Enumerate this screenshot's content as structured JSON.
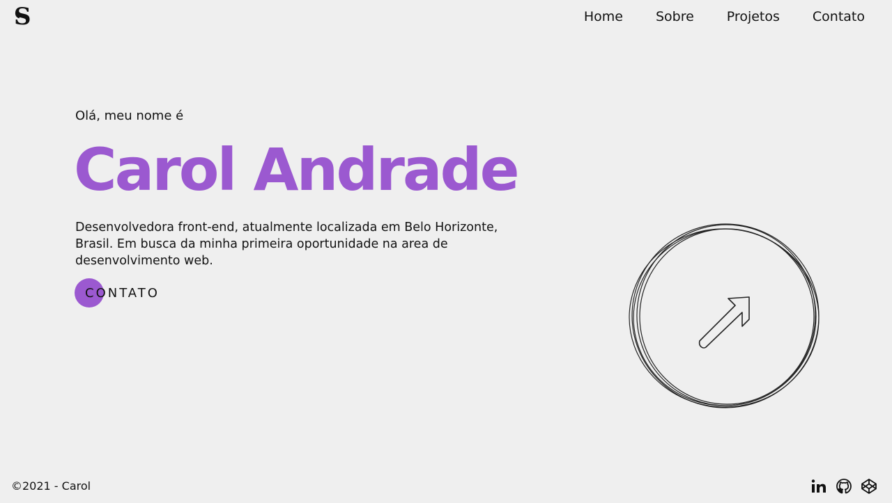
{
  "brand": {
    "logo_icon": "s-monogram-icon"
  },
  "nav": {
    "items": [
      {
        "label": "Home"
      },
      {
        "label": "Sobre"
      },
      {
        "label": "Projetos"
      },
      {
        "label": "Contato"
      }
    ]
  },
  "hero": {
    "greeting": "Olá, meu nome é",
    "name": "Carol Andrade",
    "description": "Desenvolvedora front-end, atualmente localizada em Belo Horizonte, Brasil. Em busca da minha primeira oportunidade na area de desenvolvimento web.",
    "cta_label": "CONTATO",
    "graphic_icon": "arrow-up-right-icon"
  },
  "footer": {
    "copyright": "©2021 - Carol",
    "social": [
      {
        "icon": "linkedin-icon"
      },
      {
        "icon": "github-icon"
      },
      {
        "icon": "codepen-icon"
      }
    ]
  },
  "colors": {
    "background": "#efefef",
    "accent": "#9b59d0",
    "text": "#111111"
  }
}
